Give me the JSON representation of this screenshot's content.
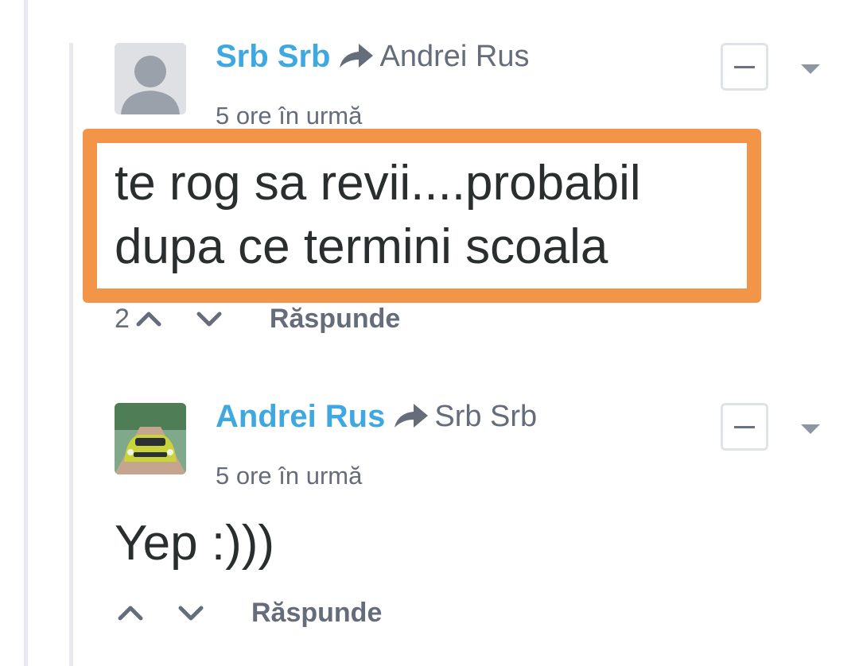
{
  "comments": [
    {
      "author": "Srb Srb",
      "recipient": "Andrei Rus",
      "time": "5 ore în urmă",
      "text": "te rog sa revii....probabil dupa ce termini scoala",
      "votes": "2",
      "reply_label": "Răspunde",
      "highlighted": true,
      "avatar": "default-avatar"
    },
    {
      "author": "Andrei Rus",
      "recipient": "Srb Srb",
      "time": "5 ore în urmă",
      "text": "Yep :)))",
      "votes": "",
      "reply_label": "Răspunde",
      "highlighted": false,
      "avatar": "car-photo-avatar"
    }
  ],
  "icons": {
    "reply_arrow": "share-arrow-icon",
    "collapse": "minus-icon",
    "menu": "chevron-down-icon",
    "upvote": "chevron-up-icon",
    "downvote": "chevron-down-icon"
  },
  "colors": {
    "author": "#3fa8e0",
    "highlight_border": "#f29548",
    "muted_text": "#656c7a",
    "body_text": "#2a2e2e"
  }
}
